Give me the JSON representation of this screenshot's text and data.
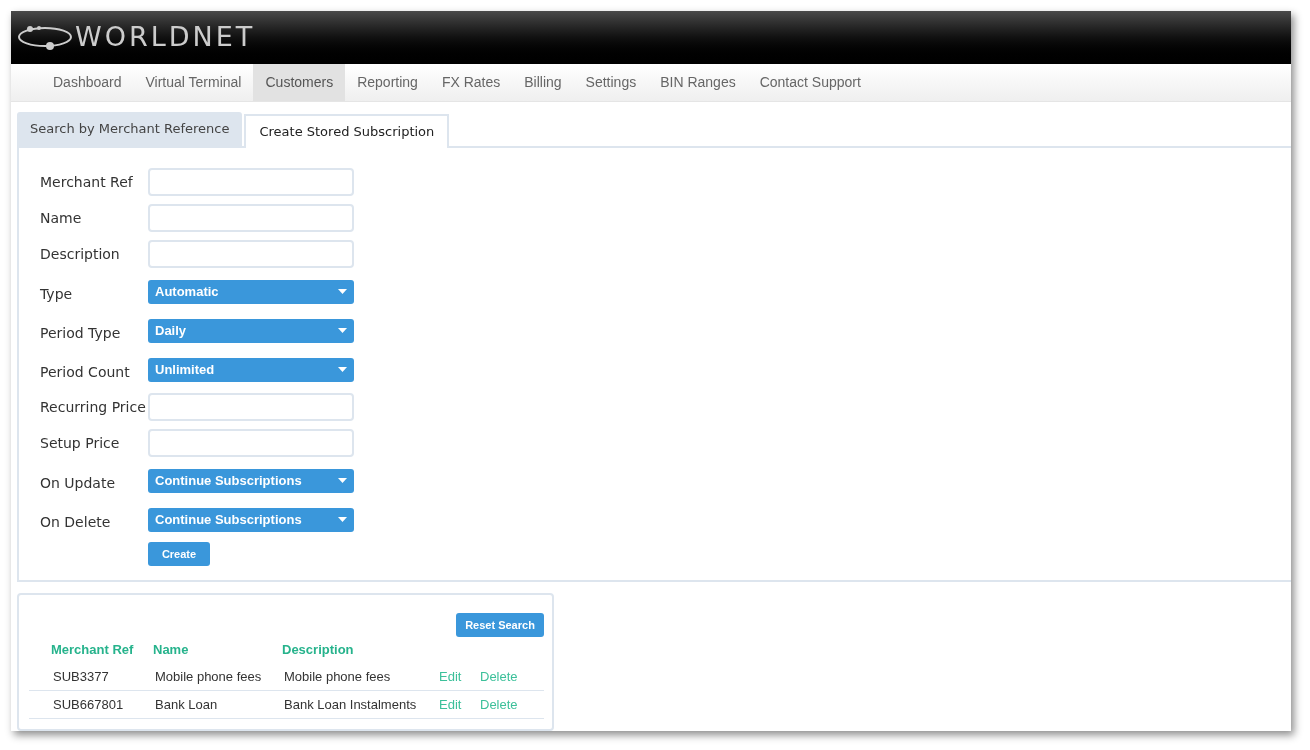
{
  "header": {
    "logo": "WORLDNET"
  },
  "nav": [
    {
      "label": "Dashboard",
      "selected": false
    },
    {
      "label": "Virtual Terminal",
      "selected": false
    },
    {
      "label": "Customers",
      "selected": true
    },
    {
      "label": "Reporting",
      "selected": false
    },
    {
      "label": "FX Rates",
      "selected": false
    },
    {
      "label": "Billing",
      "selected": false
    },
    {
      "label": "Settings",
      "selected": false
    },
    {
      "label": "BIN Ranges",
      "selected": false
    },
    {
      "label": "Contact Support",
      "selected": false
    }
  ],
  "tabs": [
    {
      "label": "Search by Merchant Reference",
      "selected": false
    },
    {
      "label": "Create Stored Subscription",
      "selected": true
    }
  ],
  "form": {
    "fields": [
      {
        "kind": "text",
        "label": "Merchant Ref"
      },
      {
        "kind": "text",
        "label": "Name"
      },
      {
        "kind": "text",
        "label": "Description"
      },
      {
        "kind": "select",
        "label": "Type",
        "value": "Automatic"
      },
      {
        "kind": "select",
        "label": "Period Type",
        "value": "Daily"
      },
      {
        "kind": "select",
        "label": "Period Count",
        "value": "Unlimited"
      },
      {
        "kind": "text",
        "label": "Recurring Price"
      },
      {
        "kind": "text",
        "label": "Setup Price"
      },
      {
        "kind": "select",
        "label": "On Update",
        "value": "Continue Subscriptions"
      },
      {
        "kind": "select",
        "label": "On Delete",
        "value": "Continue Subscriptions"
      }
    ],
    "submit": "Create"
  },
  "results": {
    "reset_button": "Reset Search",
    "columns": [
      "Merchant Ref",
      "Name",
      "Description"
    ],
    "rows": [
      {
        "merchant_ref": "SUB3377",
        "name": "Mobile phone fees",
        "description": "Mobile phone fees",
        "edit": "Edit",
        "delete": "Delete"
      },
      {
        "merchant_ref": "SUB667801",
        "name": "Bank Loan",
        "description": "Bank Loan Instalments",
        "edit": "Edit",
        "delete": "Delete"
      }
    ]
  }
}
